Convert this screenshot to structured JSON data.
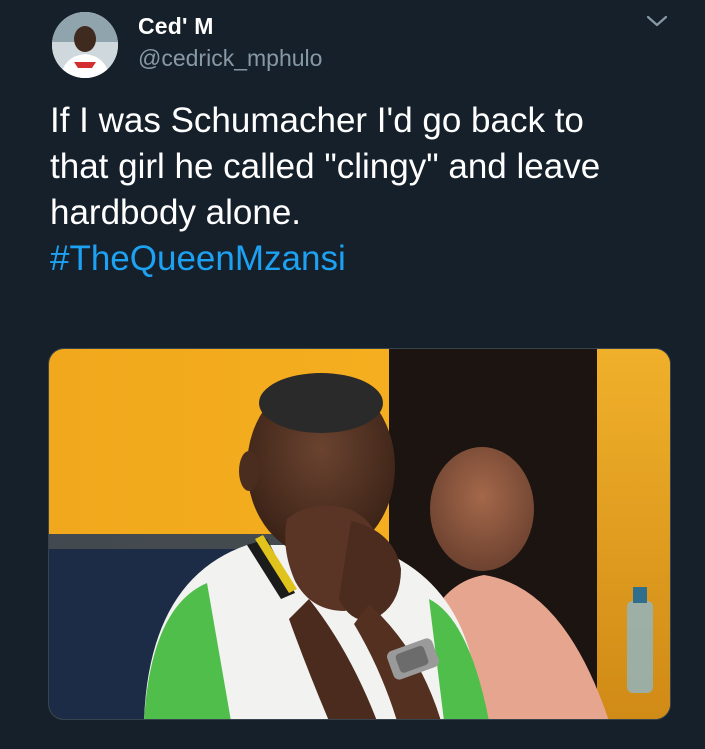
{
  "tweet": {
    "author": {
      "display_name": "Ced' M",
      "handle": "@cedrick_mphulo",
      "avatar_icon": "profile-photo"
    },
    "menu_icon": "chevron-down-icon",
    "text_lines": [
      "If I was Schumacher I'd go back to",
      "that girl he called \"clingy\" and leave",
      "hardbody alone."
    ],
    "hashtag": "#TheQueenMzansi",
    "media": {
      "kind": "photo",
      "description_icon": "attached-photo"
    }
  },
  "colors": {
    "background": "#15202b",
    "text": "#ffffff",
    "secondary_text": "#8899a6",
    "link": "#1da1f2",
    "border": "#38444d"
  }
}
